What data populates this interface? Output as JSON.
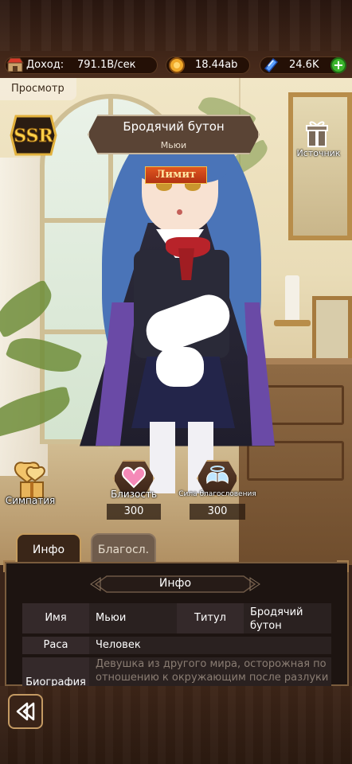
{
  "topbar": {
    "income_label": "Доход:",
    "income_value": "791.1B/сек",
    "gold_value": "18.44ab",
    "gems_value": "24.6K",
    "icons": [
      "shop-icon",
      "gold-coin-icon",
      "blue-gem-icon",
      "plus-icon"
    ]
  },
  "view_tab": {
    "label": "Просмотр"
  },
  "character": {
    "rarity": "SSR",
    "title": "Бродячий бутон",
    "name": "Мьюи",
    "limit_badge": "Лимит"
  },
  "source": {
    "label": "Источник"
  },
  "sympathy": {
    "label": "Симпатия"
  },
  "stats": [
    {
      "label": "Близость",
      "value": "300"
    },
    {
      "label": "Сила благословения",
      "value": "300"
    }
  ],
  "tabs": [
    {
      "label": "Инфо",
      "active": true
    },
    {
      "label": "Благосл.",
      "active": false
    }
  ],
  "info": {
    "heading": "Инфо",
    "rows": {
      "name_label": "Имя",
      "name_value": "Мьюи",
      "title_label": "Титул",
      "title_value": "Бродячий бутон",
      "race_label": "Раса",
      "race_value": "Человек",
      "bio_label": "Биография",
      "bio_value": "Девушка из другого мира, осторожная по отношению к окружающим после разлуки со"
    }
  },
  "colors": {
    "accent_gold": "#c59c5e",
    "panel_bg": "#1d1411",
    "limit_red": "#c23a14",
    "plus_green": "#3bb52c"
  },
  "back_button": {
    "icon": "back-arrow-icon"
  }
}
